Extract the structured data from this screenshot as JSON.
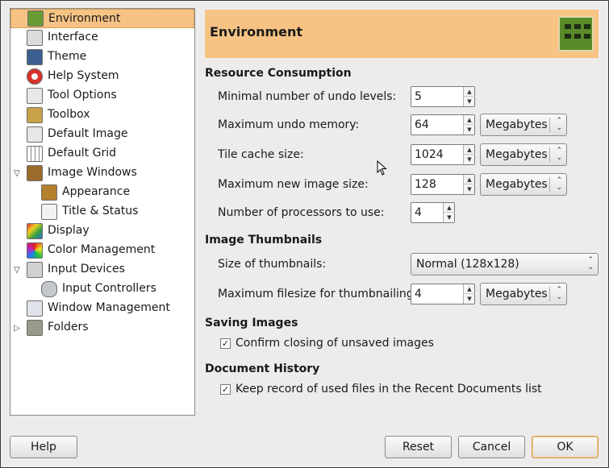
{
  "sidebar": {
    "items": [
      {
        "label": "Environment",
        "expander": ""
      },
      {
        "label": "Interface",
        "expander": ""
      },
      {
        "label": "Theme",
        "expander": ""
      },
      {
        "label": "Help System",
        "expander": ""
      },
      {
        "label": "Tool Options",
        "expander": ""
      },
      {
        "label": "Toolbox",
        "expander": ""
      },
      {
        "label": "Default Image",
        "expander": ""
      },
      {
        "label": "Default Grid",
        "expander": ""
      },
      {
        "label": "Image Windows",
        "expander": "▽"
      },
      {
        "label": "Appearance",
        "expander": ""
      },
      {
        "label": "Title & Status",
        "expander": ""
      },
      {
        "label": "Display",
        "expander": ""
      },
      {
        "label": "Color Management",
        "expander": ""
      },
      {
        "label": "Input Devices",
        "expander": "▽"
      },
      {
        "label": "Input Controllers",
        "expander": ""
      },
      {
        "label": "Window Management",
        "expander": ""
      },
      {
        "label": "Folders",
        "expander": "▷"
      }
    ],
    "selected": "Environment"
  },
  "header": {
    "title": "Environment",
    "icon": "memory-chip-icon"
  },
  "resource": {
    "title": "Resource Consumption",
    "undo_levels_label": "Minimal number of undo levels:",
    "undo_levels_value": "5",
    "undo_memory_label": "Maximum undo memory:",
    "undo_memory_value": "64",
    "undo_memory_unit": "Megabytes",
    "tile_cache_label": "Tile cache size:",
    "tile_cache_value": "1024",
    "tile_cache_unit": "Megabytes",
    "new_image_label": "Maximum new image size:",
    "new_image_value": "128",
    "new_image_unit": "Megabytes",
    "processors_label": "Number of processors to use:",
    "processors_value": "4"
  },
  "thumbnails": {
    "title": "Image Thumbnails",
    "size_label": "Size of thumbnails:",
    "size_value": "Normal (128x128)",
    "filesize_label": "Maximum filesize for thumbnailing:",
    "filesize_value": "4",
    "filesize_unit": "Megabytes"
  },
  "saving": {
    "title": "Saving Images",
    "confirm_label": "Confirm closing of unsaved images",
    "confirm_checked": true
  },
  "history": {
    "title": "Document History",
    "keep_label": "Keep record of used files in the Recent Documents list",
    "keep_checked": true
  },
  "buttons": {
    "help": "Help",
    "reset": "Reset",
    "cancel": "Cancel",
    "ok": "OK"
  },
  "colors": {
    "selection": "#f7c384",
    "background": "#edeceb"
  }
}
